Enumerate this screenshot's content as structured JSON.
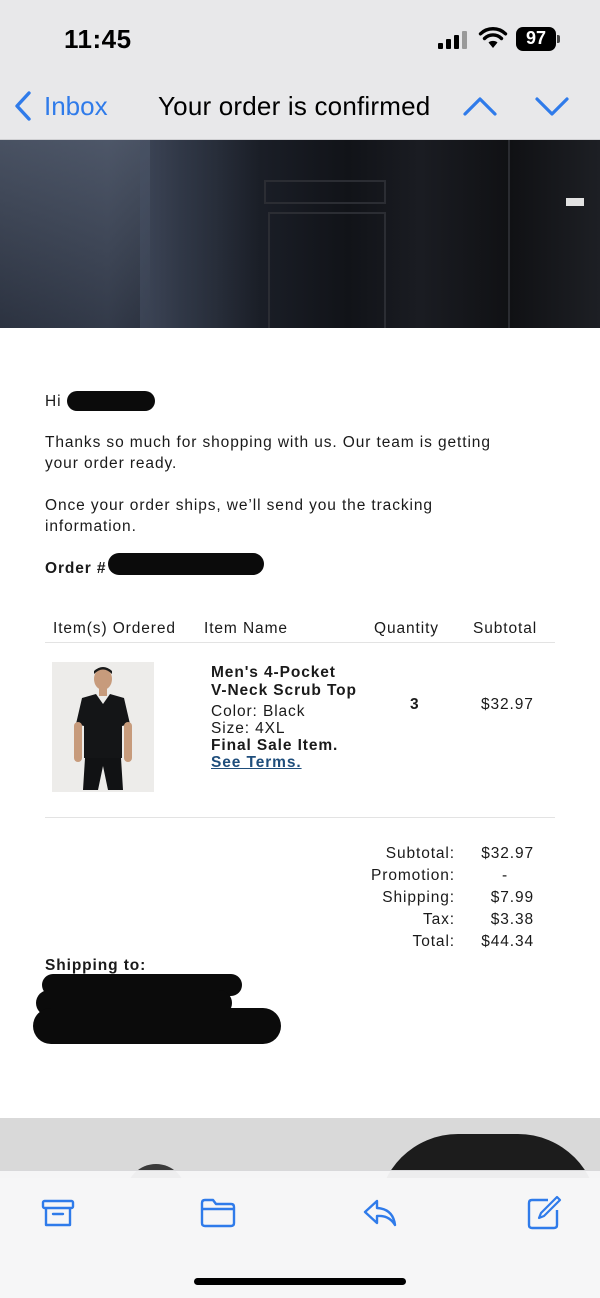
{
  "status": {
    "time": "11:45",
    "battery": "97"
  },
  "nav": {
    "back_label": "Inbox",
    "title": "Your order is confirmed"
  },
  "email": {
    "greeting": "Hi",
    "intro_line1": "Thanks so much for shopping with us. Our team is getting",
    "intro_line2": "your order ready.",
    "ship_line1": "Once your order ships, we’ll send you the tracking",
    "ship_line2": "information.",
    "order_label": "Order #"
  },
  "table": {
    "headers": [
      "Item(s) Ordered",
      "Item Name",
      "Quantity",
      "Subtotal"
    ],
    "item": {
      "name_line1": "Men's 4-Pocket",
      "name_line2": "V-Neck Scrub Top",
      "color": "Color: Black",
      "size": "Size: 4XL",
      "final_sale": "Final Sale Item.",
      "see_terms": "See Terms.",
      "quantity": "3",
      "subtotal": "$32.97"
    }
  },
  "totals": {
    "rows": [
      {
        "label": "Subtotal:",
        "value": "$32.97"
      },
      {
        "label": "Promotion:",
        "value": "-"
      },
      {
        "label": "Shipping:",
        "value": "$7.99"
      },
      {
        "label": "Tax:",
        "value": "$3.38"
      },
      {
        "label": "Total:",
        "value": "$44.34"
      }
    ]
  },
  "shipping": {
    "label": "Shipping to:"
  },
  "colors": {
    "accent": "#2f7bea",
    "link": "#1e4d7b"
  },
  "toolbar": {
    "icons": [
      "archive-icon",
      "folder-icon",
      "reply-icon",
      "compose-icon"
    ]
  }
}
